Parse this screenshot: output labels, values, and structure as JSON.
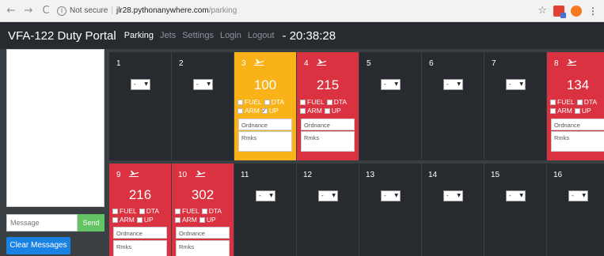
{
  "browser": {
    "security_label": "Not secure",
    "url_host": "jlr28.pythonanywhere.com",
    "url_path": "/parking"
  },
  "navbar": {
    "brand": "VFA-122 Duty Portal",
    "links": [
      "Parking",
      "Jets",
      "Settings",
      "Login",
      "Logout"
    ],
    "clock": "- 20:38:28"
  },
  "sidebar": {
    "message_placeholder": "Message",
    "send_label": "Send",
    "clear_label": "Clear Messages"
  },
  "spot_labels": {
    "select_value": "-",
    "fuel": "FUEL",
    "dta": "DTA",
    "arm": "ARM",
    "up": "UP",
    "ordnance": "Ordnance",
    "remarks": "Rmks"
  },
  "spots": [
    {
      "number": "1",
      "status": "empty"
    },
    {
      "number": "2",
      "status": "empty"
    },
    {
      "number": "3",
      "status": "warn",
      "jet": "100",
      "fuel": false,
      "dta": false,
      "arm": false,
      "up": true
    },
    {
      "number": "4",
      "status": "danger",
      "jet": "215",
      "fuel": false,
      "dta": false,
      "arm": false,
      "up": false
    },
    {
      "number": "5",
      "status": "empty"
    },
    {
      "number": "6",
      "status": "empty"
    },
    {
      "number": "7",
      "status": "empty"
    },
    {
      "number": "8",
      "status": "danger",
      "jet": "134",
      "fuel": false,
      "dta": false,
      "arm": false,
      "up": false
    },
    {
      "number": "9",
      "status": "danger",
      "jet": "216",
      "fuel": false,
      "dta": false,
      "arm": false,
      "up": false
    },
    {
      "number": "10",
      "status": "danger",
      "jet": "302",
      "fuel": false,
      "dta": false,
      "arm": false,
      "up": false
    },
    {
      "number": "11",
      "status": "empty"
    },
    {
      "number": "12",
      "status": "empty"
    },
    {
      "number": "13",
      "status": "empty"
    },
    {
      "number": "14",
      "status": "empty"
    },
    {
      "number": "15",
      "status": "empty"
    },
    {
      "number": "16",
      "status": "empty"
    }
  ],
  "colors": {
    "warn": "#f9b217",
    "danger": "#da3240",
    "empty": "#272b30"
  },
  "icons": {
    "jet": "airplane-takeoff-icon"
  }
}
